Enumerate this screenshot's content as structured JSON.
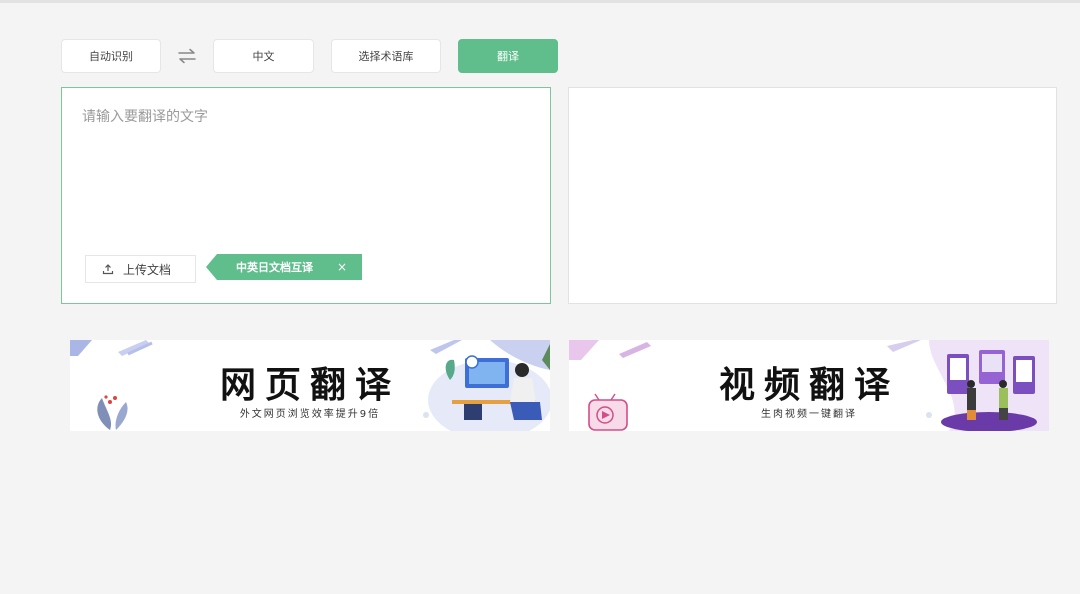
{
  "colors": {
    "accent": "#5fbe8b",
    "background": "#f4f4f5",
    "panel_border": "#7cc69c"
  },
  "toolbar": {
    "source_language": "自动识别",
    "swap_icon": "swap-arrows-icon",
    "target_language": "中文",
    "glossary_label": "选择术语库",
    "translate_label": "翻译"
  },
  "input": {
    "placeholder": "请输入要翻译的文字",
    "value": "",
    "upload_label": "上传文档",
    "upload_icon": "upload-icon",
    "doc_tag_label": "中英日文档互译",
    "doc_tag_close": "×"
  },
  "output": {
    "value": ""
  },
  "banners": [
    {
      "title": "网页翻译",
      "subtitle": "外文网页浏览效率提升9倍"
    },
    {
      "title": "视频翻译",
      "subtitle": "生肉视频一键翻译"
    }
  ]
}
